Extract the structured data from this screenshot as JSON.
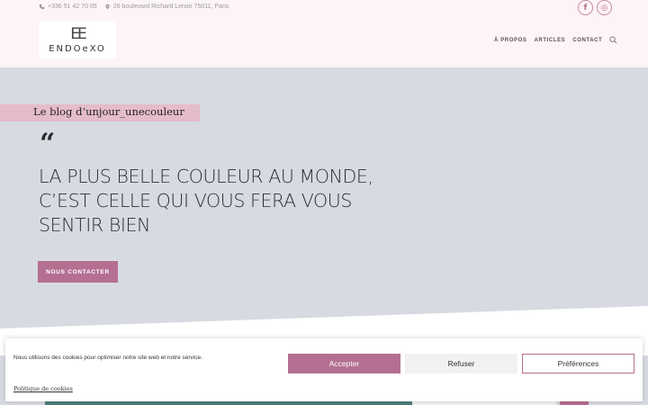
{
  "header": {
    "phone": "+336 51 42 70 05",
    "address": "26 boulevard Richard Lenoir 75011, Paris",
    "logo_mark": "EE",
    "logo_text": "ENDOeXO",
    "nav": [
      "À PROPOS",
      "ARTICLES",
      "CONTACT"
    ],
    "socials": [
      "f",
      "◎"
    ]
  },
  "hero": {
    "tag": "Le blog d’unjour_unecouleur",
    "quote_mark": "“",
    "headline": [
      "LA PLUS BELLE COULEUR AU MONDE,",
      "C’EST CELLE QUI VOUS FERA VOUS",
      "SENTIR BIEN"
    ],
    "cta": "NOUS CONTACTER"
  },
  "cookie": {
    "message": "Nous utilisons des cookies pour optimiser notre site web et notre service.",
    "accept": "Accepter",
    "refuse": "Refuser",
    "preferences": "Préférences",
    "policy": "Politique de cookies"
  },
  "colors": {
    "accent": "#b46f92",
    "tag_bg": "#e5bcca",
    "hero_bg": "#d7dae1",
    "topbar_bg": "#fdf4f5"
  }
}
